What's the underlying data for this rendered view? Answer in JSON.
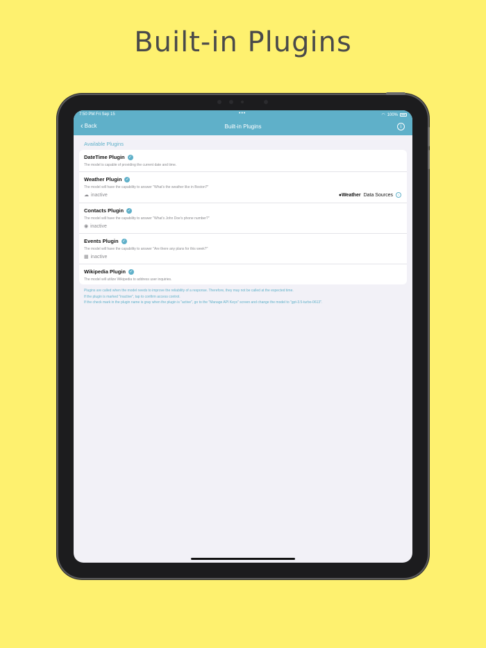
{
  "headline": "Built-in Plugins",
  "status_bar": {
    "time": "7:50 PM  Fri Sep 15",
    "dots": "•••",
    "battery": "100%"
  },
  "nav": {
    "back": "Back",
    "title": "Built-in Plugins",
    "info": "i"
  },
  "section_title": "Available Plugins",
  "plugins": [
    {
      "name": "DateTime Plugin",
      "description": "The model is capable of providing the current date and time."
    },
    {
      "name": "Weather Plugin",
      "description": "The model will have the capability to answer \"What's the weather like in Boston?\"",
      "status": "inactive",
      "status_icon": "cloud-icon"
    },
    {
      "name": "Contacts Plugin",
      "description": "The model will have the capability to answer \"What's John Doe's phone number?\"",
      "status": "inactive",
      "status_icon": "person-icon"
    },
    {
      "name": "Events Plugin",
      "description": "The model will have the capability to answer \"Are there any plans for this week?\"",
      "status": "inactive",
      "status_icon": "calendar-icon"
    },
    {
      "name": "Wikipedia Plugin",
      "description": "The model will utilize Wikipedia to address user inquiries."
    }
  ],
  "weather_attribution": {
    "brand": "Weather",
    "link": "Data Sources"
  },
  "footer_notes": [
    "Plugins are called when the model needs to improve the reliability of a response. Therefore, they may not be called at the expected time.",
    "If the plugin is marked \"inactive\", tap to confirm access control.",
    "If the check mark in the plugin name is gray when the plugin is \"active\", go to the \"Manage API Keys\" screen and change the model to \"gpt-3.5-turbo-0613\"."
  ],
  "colors": {
    "background": "#fef16f",
    "accent": "#5fb0c9",
    "screen": "#f2f1f7"
  }
}
